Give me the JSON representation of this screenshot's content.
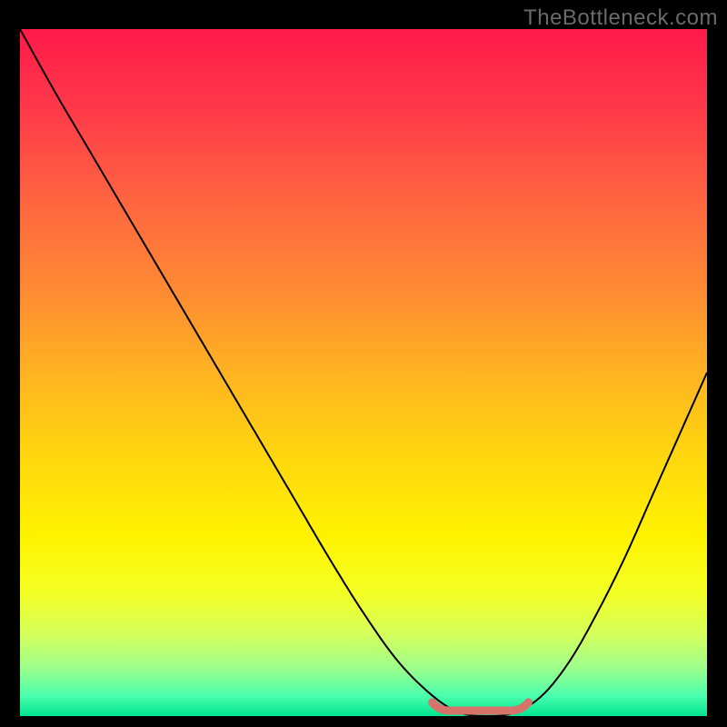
{
  "watermark": "TheBottleneck.com",
  "chart_data": {
    "type": "line",
    "title": "",
    "xlabel": "",
    "ylabel": "",
    "xlim": [
      0,
      100
    ],
    "ylim": [
      0,
      100
    ],
    "series": [
      {
        "name": "curve",
        "x": [
          0,
          5,
          10,
          15,
          20,
          25,
          30,
          35,
          40,
          45,
          50,
          55,
          60,
          64,
          68,
          72,
          76,
          80,
          84,
          88,
          92,
          96,
          100
        ],
        "values": [
          100,
          91,
          82.5,
          74,
          65.5,
          57,
          48.5,
          40,
          31.5,
          23,
          15,
          8,
          3,
          0.5,
          0,
          0.5,
          3,
          8,
          15,
          23,
          32,
          41,
          50
        ]
      }
    ],
    "highlight_marker": {
      "name": "bottleneck-range",
      "x_range": [
        60,
        74
      ],
      "y": 0,
      "color": "#d6736b"
    },
    "gradient_stops": [
      {
        "offset": 0.0,
        "color": "#ff1a4b"
      },
      {
        "offset": 0.12,
        "color": "#ff3a49"
      },
      {
        "offset": 0.25,
        "color": "#ff6540"
      },
      {
        "offset": 0.38,
        "color": "#ff8a33"
      },
      {
        "offset": 0.5,
        "color": "#ffb321"
      },
      {
        "offset": 0.62,
        "color": "#ffd60f"
      },
      {
        "offset": 0.74,
        "color": "#fff300"
      },
      {
        "offset": 0.82,
        "color": "#f4ff24"
      },
      {
        "offset": 0.88,
        "color": "#d6ff5a"
      },
      {
        "offset": 0.93,
        "color": "#9dff8c"
      },
      {
        "offset": 0.97,
        "color": "#4bffad"
      },
      {
        "offset": 1.0,
        "color": "#00e38f"
      }
    ]
  }
}
